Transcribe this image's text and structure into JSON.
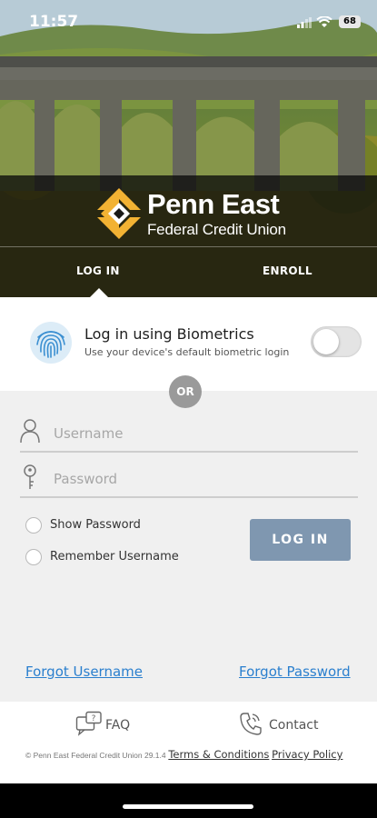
{
  "status_bar": {
    "time": "11:57",
    "battery": "68"
  },
  "brand": {
    "name": "Penn East",
    "subtitle": "Federal Credit Union"
  },
  "tabs": {
    "login": "LOG IN",
    "enroll": "ENROLL"
  },
  "biometric": {
    "title": "Log in using Biometrics",
    "description": "Use your device's default biometric login",
    "enabled": false
  },
  "divider": {
    "or": "OR"
  },
  "form": {
    "username_placeholder": "Username",
    "password_placeholder": "Password",
    "show_password": "Show Password",
    "remember_username": "Remember Username",
    "login_button": "LOG IN"
  },
  "links": {
    "forgot_username": "Forgot Username",
    "forgot_password": "Forgot Password"
  },
  "footer": {
    "faq": "FAQ",
    "contact": "Contact",
    "copyright": "© Penn East Federal Credit Union 29.1.4",
    "terms": "Terms & Conditions",
    "privacy": "Privacy Policy"
  },
  "colors": {
    "accent_gold": "#f2b233",
    "link_blue": "#2a7fce",
    "button_blue_gray": "#7f97b0"
  }
}
